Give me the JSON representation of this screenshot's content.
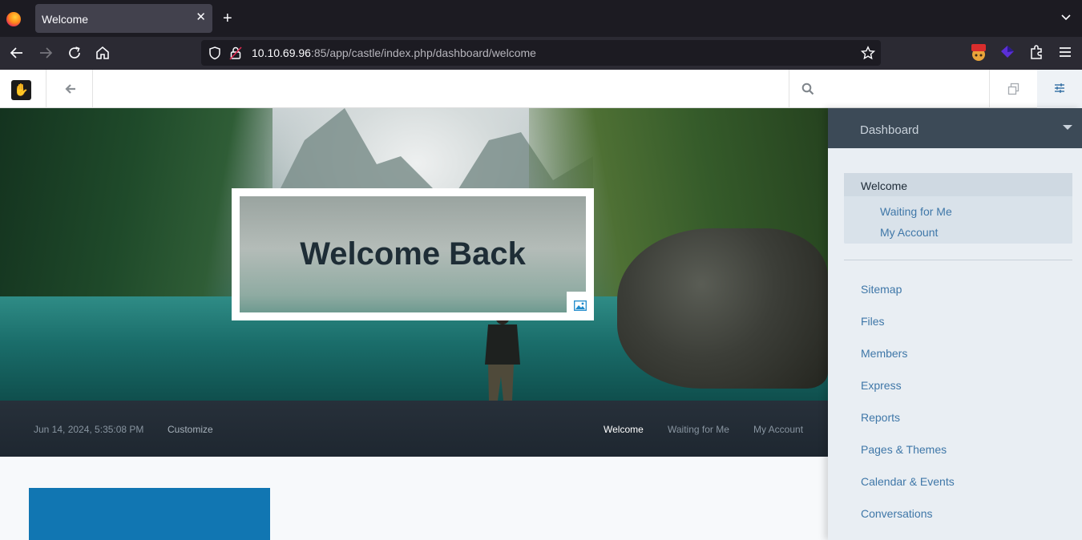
{
  "browser": {
    "tab_title": "Welcome",
    "tab_close": "✕",
    "new_tab": "+",
    "url_host": "10.10.69.96",
    "url_rest": ":85/app/castle/index.php/dashboard/welcome"
  },
  "hero": {
    "title": "Welcome Back"
  },
  "hero_bar": {
    "date": "Jun 14, 2024, 5:35:08 PM",
    "customize": "Customize",
    "links": [
      "Welcome",
      "Waiting for Me",
      "My Account"
    ]
  },
  "panel": {
    "header": "Dashboard",
    "sub_title": "Welcome",
    "sub_items": [
      "Waiting for Me",
      "My Account"
    ],
    "items": [
      "Sitemap",
      "Files",
      "Members",
      "Express",
      "Reports",
      "Pages & Themes",
      "Calendar & Events",
      "Conversations"
    ]
  },
  "colors": {
    "accent": "#3f77a8",
    "panel_header": "#3c4a57",
    "tile_blue": "#1176b2"
  }
}
